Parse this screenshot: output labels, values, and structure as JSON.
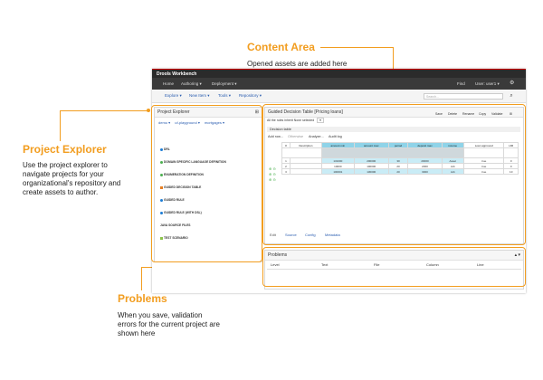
{
  "callouts": {
    "content_area": {
      "title": "Content Area",
      "text": "Opened assets are added here"
    },
    "project_explorer": {
      "title": "Project Explorer",
      "lines": [
        "Use the project explorer to",
        "navigate projects for your",
        "organizational's repository and",
        "create assets to author."
      ]
    },
    "problems": {
      "title": "Problems",
      "lines": [
        "When you save, validation",
        "errors for the current project are",
        "shown here"
      ]
    }
  },
  "app": {
    "title": "Drools Workbench",
    "nav": {
      "home": "Home",
      "authoring": "Authoring ▾",
      "deployment": "Deployment ▾",
      "find": "Find",
      "user": "User: user1 ▾",
      "settings_icon": "gear-icon"
    },
    "menu": {
      "explore": "Explore ▾",
      "new_item": "New Item ▾",
      "tools": "Tools ▾",
      "repository": "Repository ▾"
    },
    "search": {
      "placeholder": "Search..."
    },
    "project_explorer": {
      "title": "Project Explorer",
      "org": "demo ▾",
      "repo": "uf-playground ▾",
      "project": "mortgages ▾",
      "items": [
        {
          "label": "DRL",
          "color": "#1c7cd5"
        },
        {
          "label": "DOMAIN SPECIFIC LANGUAGE DEFINITION",
          "color": "#4caf50"
        },
        {
          "label": "ENUMERATION DEFINITION",
          "color": "#4caf50"
        },
        {
          "label": "GUIDED DECISION TABLE",
          "color": "#e67e22"
        },
        {
          "label": "GUIDED RULE",
          "color": "#1c7cd5"
        },
        {
          "label": "GUIDED RULE (WITH DSL)",
          "color": "#1c7cd5"
        },
        {
          "label": "JAVA SOURCE FILES",
          "color": ""
        },
        {
          "label": "TEST SCENARIO",
          "color": "#8bc34a"
        }
      ]
    },
    "editor": {
      "title": "Guided Decision Table [Pricing loans]",
      "toolbar": {
        "save": "Save",
        "delete": "Delete",
        "rename": "Rename",
        "copy": "Copy",
        "validate": "Validate"
      },
      "hit_policy": "All the rules inherit None selected",
      "section": "Decision table",
      "tabs": {
        "add_row": "Add row...",
        "otherwise": "Otherwise",
        "analyze": "Analyze...",
        "audit_log": "Audit log"
      },
      "columns": [
        "#",
        "Description",
        "amount min",
        "amount max",
        "period",
        "deposit max",
        "income",
        "Loan approved",
        "LMI"
      ],
      "rows": [
        [
          "1",
          "",
          "131000",
          "200000",
          "30",
          "20000",
          "Asset",
          "true",
          "0"
        ],
        [
          "2",
          "",
          "10000",
          "100000",
          "20",
          "2000",
          "Job",
          "true",
          "0"
        ],
        [
          "3",
          "",
          "100001",
          "130000",
          "20",
          "3000",
          "Job",
          "true",
          "10"
        ]
      ],
      "bottom_tabs": {
        "edit": "Edit",
        "source": "Source",
        "config": "Config",
        "metadata": "Metadata"
      }
    },
    "problems": {
      "title": "Problems",
      "columns": {
        "level": "Level",
        "text": "Text",
        "file": "File",
        "column": "Column",
        "line": "Line"
      }
    }
  }
}
